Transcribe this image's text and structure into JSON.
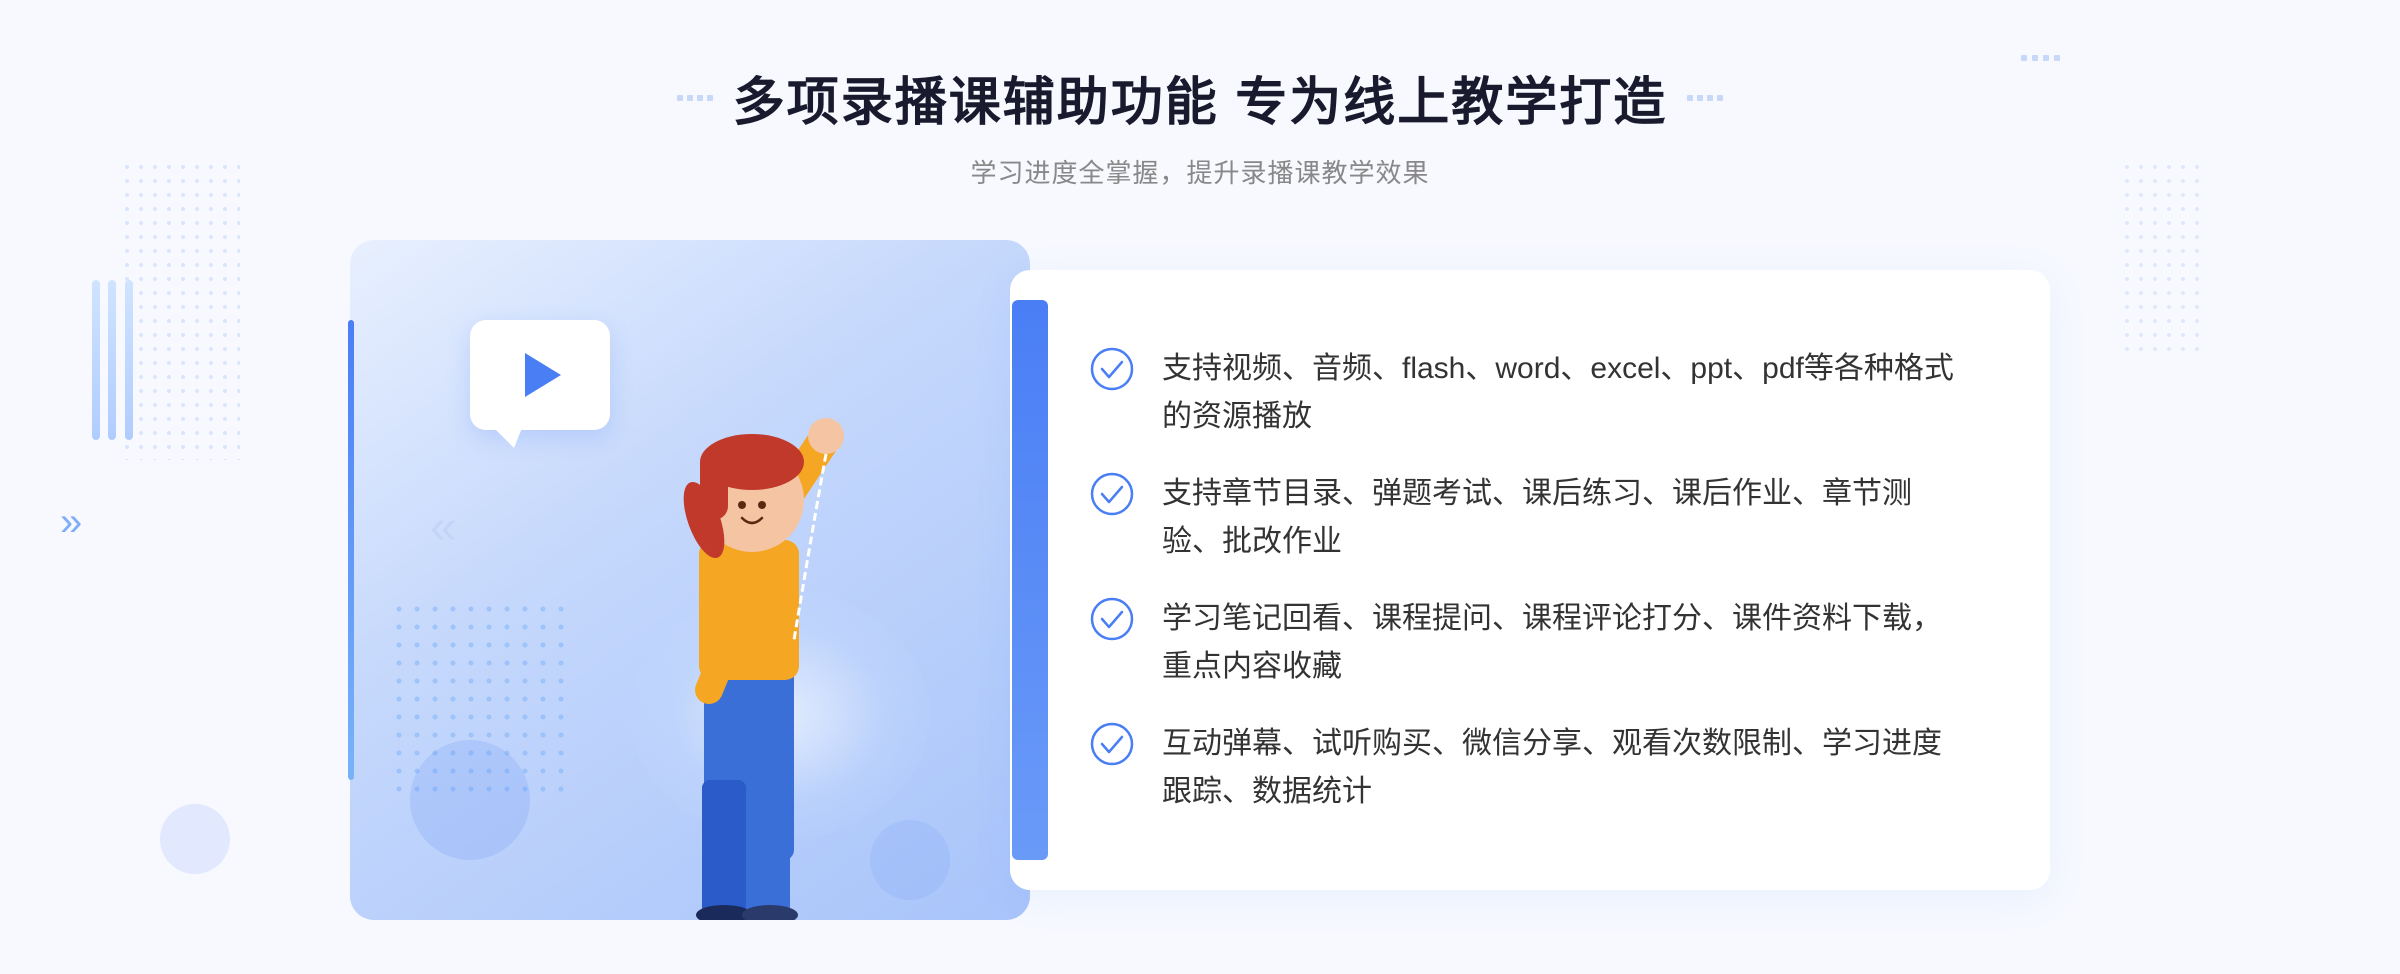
{
  "header": {
    "title": "多项录播课辅助功能 专为线上教学打造",
    "subtitle": "学习进度全掌握，提升录播课教学效果"
  },
  "features": [
    {
      "id": "feature-1",
      "text": "支持视频、音频、flash、word、excel、ppt、pdf等各种格式的资源播放"
    },
    {
      "id": "feature-2",
      "text": "支持章节目录、弹题考试、课后练习、课后作业、章节测验、批改作业"
    },
    {
      "id": "feature-3",
      "text": "学习笔记回看、课程提问、课程评论打分、课件资料下载，重点内容收藏"
    },
    {
      "id": "feature-4",
      "text": "互动弹幕、试听购买、微信分享、观看次数限制、学习进度跟踪、数据统计"
    }
  ],
  "decorators": {
    "left_arrow": "»",
    "check_color": "#4a7ef5"
  }
}
